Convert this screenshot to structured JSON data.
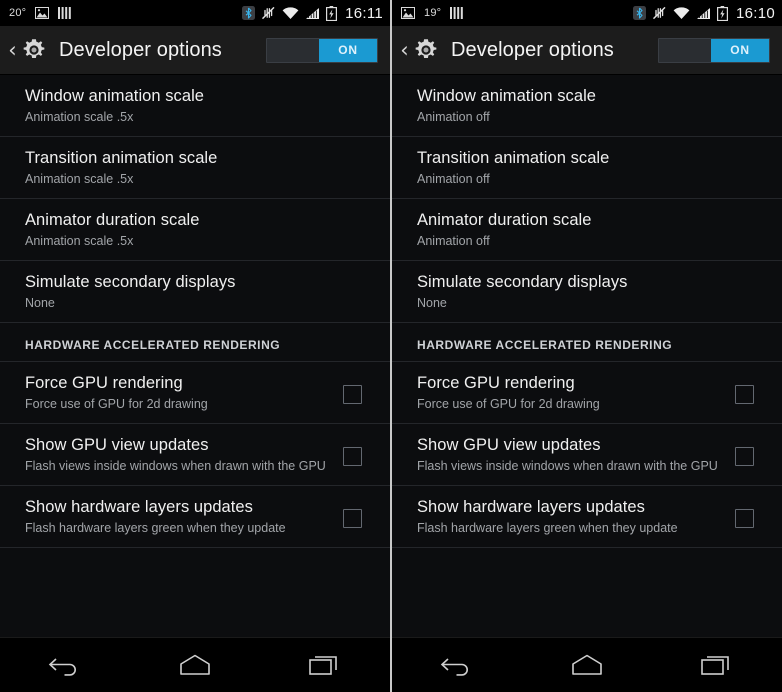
{
  "panels": [
    {
      "id": "left",
      "statusbar": {
        "temperature": "20°",
        "time": "16:11",
        "left_icons": [
          "temperature-text",
          "image-icon",
          "barcode-icon"
        ],
        "right_icons": [
          "bluetooth-icon",
          "vibrate-muted-icon",
          "wifi-icon",
          "signal-icon",
          "battery-charging-icon"
        ]
      },
      "actionbar": {
        "back_glyph": "‹",
        "icon": "gear-icon",
        "title": "Developer options",
        "switch_label": "ON",
        "switch_state": "on",
        "switch_color": "#1b9ad2"
      },
      "rows": [
        {
          "type": "setting",
          "title": "Window animation scale",
          "sub": "Animation scale .5x"
        },
        {
          "type": "setting",
          "title": "Transition animation scale",
          "sub": "Animation scale .5x"
        },
        {
          "type": "setting",
          "title": "Animator duration scale",
          "sub": "Animation scale .5x"
        },
        {
          "type": "setting",
          "title": "Simulate secondary displays",
          "sub": "None"
        },
        {
          "type": "section",
          "title": "HARDWARE ACCELERATED RENDERING"
        },
        {
          "type": "checkbox",
          "title": "Force GPU rendering",
          "sub": "Force use of GPU for 2d drawing",
          "checked": false
        },
        {
          "type": "checkbox",
          "title": "Show GPU view updates",
          "sub": "Flash views inside windows when drawn with the GPU",
          "checked": false
        },
        {
          "type": "checkbox",
          "title": "Show hardware layers updates",
          "sub": "Flash hardware layers green when they update",
          "checked": false
        }
      ],
      "navbar": [
        "back-icon",
        "home-icon",
        "recents-icon"
      ]
    },
    {
      "id": "right",
      "statusbar": {
        "temperature": "19°",
        "time": "16:10",
        "left_icons": [
          "image-icon",
          "temperature-text",
          "barcode-icon"
        ],
        "right_icons": [
          "bluetooth-icon",
          "vibrate-muted-icon",
          "wifi-icon",
          "signal-icon",
          "battery-charging-icon"
        ]
      },
      "actionbar": {
        "back_glyph": "‹",
        "icon": "gear-icon",
        "title": "Developer options",
        "switch_label": "ON",
        "switch_state": "on",
        "switch_color": "#1b9ad2"
      },
      "rows": [
        {
          "type": "setting",
          "title": "Window animation scale",
          "sub": "Animation off"
        },
        {
          "type": "setting",
          "title": "Transition animation scale",
          "sub": "Animation off"
        },
        {
          "type": "setting",
          "title": "Animator duration scale",
          "sub": "Animation off"
        },
        {
          "type": "setting",
          "title": "Simulate secondary displays",
          "sub": "None"
        },
        {
          "type": "section",
          "title": "HARDWARE ACCELERATED RENDERING"
        },
        {
          "type": "checkbox",
          "title": "Force GPU rendering",
          "sub": "Force use of GPU for 2d drawing",
          "checked": false
        },
        {
          "type": "checkbox",
          "title": "Show GPU view updates",
          "sub": "Flash views inside windows when drawn with the GPU",
          "checked": false
        },
        {
          "type": "checkbox",
          "title": "Show hardware layers updates",
          "sub": "Flash hardware layers green when they update",
          "checked": false
        }
      ],
      "navbar": [
        "back-icon",
        "home-icon",
        "recents-icon"
      ]
    }
  ]
}
